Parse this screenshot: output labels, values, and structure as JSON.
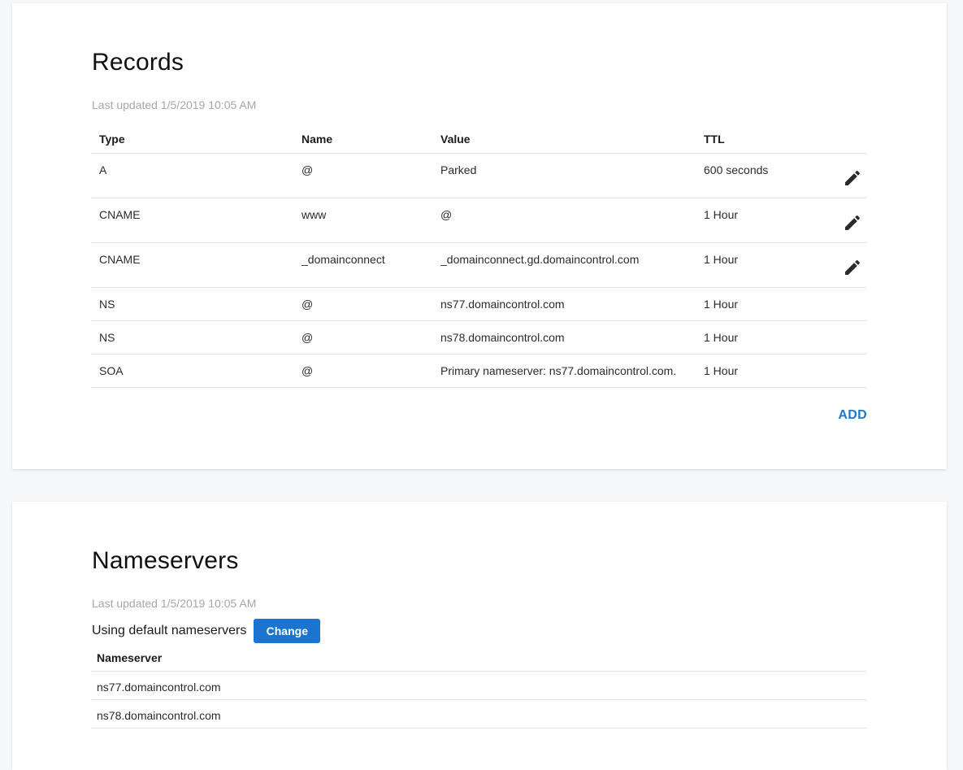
{
  "records": {
    "title": "Records",
    "last_updated": "Last updated 1/5/2019 10:05 AM",
    "columns": {
      "type": "Type",
      "name": "Name",
      "value": "Value",
      "ttl": "TTL"
    },
    "rows": [
      {
        "type": "A",
        "name": "@",
        "value": "Parked",
        "ttl": "600 seconds",
        "editable": true
      },
      {
        "type": "CNAME",
        "name": "www",
        "value": "@",
        "ttl": "1 Hour",
        "editable": true
      },
      {
        "type": "CNAME",
        "name": "_domainconnect",
        "value": "_domainconnect.gd.domaincontrol.com",
        "ttl": "1 Hour",
        "editable": true
      },
      {
        "type": "NS",
        "name": "@",
        "value": "ns77.domaincontrol.com",
        "ttl": "1 Hour",
        "editable": false
      },
      {
        "type": "NS",
        "name": "@",
        "value": "ns78.domaincontrol.com",
        "ttl": "1 Hour",
        "editable": false
      },
      {
        "type": "SOA",
        "name": "@",
        "value": "Primary nameserver: ns77.domaincontrol.com.",
        "ttl": "1 Hour",
        "editable": false
      }
    ],
    "edit_icon": "pencil-icon",
    "add_label": "ADD",
    "accent_color": "#1f7ac8"
  },
  "nameservers": {
    "title": "Nameservers",
    "last_updated": "Last updated 1/5/2019 10:05 AM",
    "status_text": "Using default nameservers",
    "change_label": "Change",
    "change_color": "#1b74d0",
    "column_header": "Nameserver",
    "rows": [
      "ns77.domaincontrol.com",
      "ns78.domaincontrol.com"
    ]
  }
}
